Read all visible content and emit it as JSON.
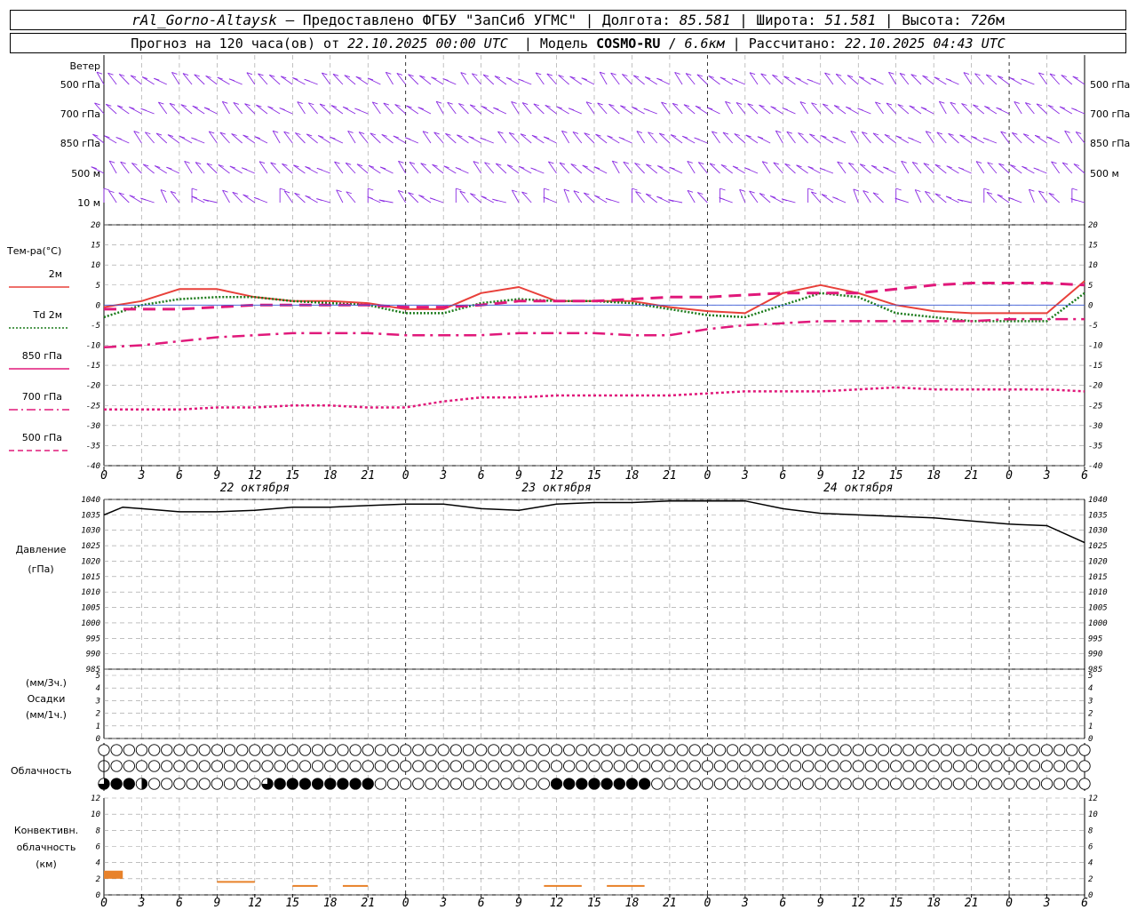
{
  "header": {
    "station": "rAl_Gorno-Altaysk",
    "provider": "Предоставлено ФГБУ \"ЗапСиб УГМС\"",
    "lon_label": "Долгота:",
    "lon": "85.581",
    "lat_label": "Широта:",
    "lat": "51.581",
    "alt_label": "Высота:",
    "alt": "726",
    "alt_unit": "м",
    "forecast_prefix": "Прогноз на 120 часа(ов) от",
    "forecast_from": "22.10.2025 00:00 UTC",
    "model_label": "Модель",
    "model": "COSMO-RU",
    "resolution": "6.6км",
    "computed_label": "Рассчитано:",
    "computed": "22.10.2025 04:43 UTC"
  },
  "colors": {
    "wind": "#8a2be2",
    "t2m": "#e8403a",
    "td2m": "#1a7a1a",
    "t850": "#e0187a",
    "t700": "#e0187a",
    "t500": "#e0187a",
    "grid": "#999999",
    "pressure": "#000000",
    "convective": "#e8822a"
  },
  "wind_panel": {
    "title": "Ветер",
    "levels": [
      "500 гПа",
      "700 гПа",
      "850 гПа",
      "500 м",
      "10 м"
    ]
  },
  "temp_panel": {
    "title": "Тем-ра(°С)",
    "legend": [
      {
        "label": "2м",
        "style": "solid",
        "color": "#e8403a"
      },
      {
        "label": "Td  2м",
        "style": "dotted",
        "color": "#1a7a1a"
      },
      {
        "label": "850 гПа",
        "style": "solid",
        "color": "#e0187a"
      },
      {
        "label": "700 гПа",
        "style": "dashdot",
        "color": "#e0187a"
      },
      {
        "label": "500 гПа",
        "style": "dashed",
        "color": "#e0187a"
      }
    ]
  },
  "pressure_panel": {
    "label1": "Давление",
    "label2": "(гПа)"
  },
  "precip_panel": {
    "label1": "(мм/3ч.)",
    "label2": "Осадки",
    "label3": "(мм/1ч.)"
  },
  "cloud_panel": {
    "label": "Облачность"
  },
  "conv_panel": {
    "label1": "Конвективн.",
    "label2": "облачность",
    "label3": "(км)"
  },
  "x_ticks": [
    "0",
    "3",
    "6",
    "9",
    "12",
    "15",
    "18",
    "21",
    "0",
    "3",
    "6",
    "9",
    "12",
    "15",
    "18",
    "21",
    "0",
    "3",
    "6",
    "9",
    "12",
    "15",
    "18",
    "21",
    "0",
    "3",
    "6"
  ],
  "day_labels": [
    "22 октября",
    "23 октября",
    "24 октября"
  ],
  "chart_data": [
    {
      "type": "line",
      "title": "Тем-ра(°С)",
      "x_hours": [
        0,
        3,
        6,
        9,
        12,
        15,
        18,
        21,
        24,
        27,
        30,
        33,
        36,
        39,
        42,
        45,
        48,
        51,
        54,
        57,
        60,
        63,
        66,
        69,
        72,
        75,
        78
      ],
      "ylim": [
        -40,
        20
      ],
      "yticks": [
        -40,
        -35,
        -30,
        -25,
        -20,
        -15,
        -10,
        -5,
        0,
        5,
        10,
        15,
        20
      ],
      "series": [
        {
          "name": "2м",
          "values": [
            -0.5,
            1,
            4,
            4,
            2,
            1,
            1,
            0.5,
            -1,
            -1,
            3,
            4.5,
            1,
            1,
            1,
            -0.5,
            -1.5,
            -2,
            3,
            5,
            3,
            0,
            -1.5,
            -2,
            -2,
            -2,
            6
          ]
        },
        {
          "name": "Td  2м",
          "values": [
            -3,
            0,
            1.5,
            2,
            2,
            1,
            0.5,
            0,
            -2,
            -2,
            0.5,
            1.5,
            1,
            1,
            0.5,
            -1,
            -2.5,
            -3,
            0,
            3,
            2,
            -2,
            -3,
            -4,
            -4,
            -4,
            3
          ]
        },
        {
          "name": "850 гПа",
          "values": [
            -1,
            -1,
            -1,
            -0.5,
            0,
            0,
            0,
            0,
            -0.5,
            -0.5,
            0,
            1,
            1,
            1,
            1.5,
            2,
            2,
            2.5,
            3,
            3,
            3,
            4,
            5,
            5.5,
            5.5,
            5.5,
            5
          ]
        },
        {
          "name": "700 гПа",
          "values": [
            -10.5,
            -10,
            -9,
            -8,
            -7.5,
            -7,
            -7,
            -7,
            -7.5,
            -7.5,
            -7.5,
            -7,
            -7,
            -7,
            -7.5,
            -7.5,
            -6,
            -5,
            -4.5,
            -4,
            -4,
            -4,
            -4,
            -4,
            -3.5,
            -3.5,
            -3.5
          ]
        },
        {
          "name": "500 гПа",
          "values": [
            -26,
            -26,
            -26,
            -25.5,
            -25.5,
            -25,
            -25,
            -25.5,
            -25.5,
            -24,
            -23,
            -23,
            -22.5,
            -22.5,
            -22.5,
            -22.5,
            -22,
            -21.5,
            -21.5,
            -21.5,
            -21,
            -20.5,
            -21,
            -21,
            -21,
            -21,
            -21.5
          ]
        }
      ]
    },
    {
      "type": "line",
      "title": "Давление (гПа)",
      "x_hours": [
        0,
        1.5,
        3,
        6,
        9,
        12,
        15,
        18,
        21,
        24,
        27,
        30,
        33,
        36,
        39,
        42,
        45,
        48,
        51,
        54,
        57,
        60,
        63,
        66,
        69,
        72,
        75,
        78
      ],
      "ylim": [
        985,
        1040
      ],
      "yticks": [
        985,
        990,
        995,
        1000,
        1005,
        1010,
        1015,
        1020,
        1025,
        1030,
        1035,
        1040
      ],
      "series": [
        {
          "name": "Давление",
          "values": [
            1035,
            1037.5,
            1037,
            1036,
            1036,
            1036.5,
            1037.5,
            1037.5,
            1038,
            1038.5,
            1038.5,
            1037,
            1036.5,
            1038.5,
            1039,
            1039,
            1039.5,
            1039.5,
            1039.5,
            1037,
            1035.5,
            1035,
            1034.5,
            1034,
            1033,
            1032,
            1031.5,
            1026
          ]
        }
      ]
    },
    {
      "type": "bar",
      "title": "Осадки",
      "ylim": [
        0,
        5
      ],
      "yticks": [
        0,
        1,
        2,
        3,
        4,
        5
      ],
      "values": []
    },
    {
      "type": "bar",
      "title": "Конвективн. облачность (км)",
      "ylim": [
        0,
        12
      ],
      "yticks": [
        0,
        2,
        4,
        6,
        8,
        10,
        12
      ],
      "segments": [
        {
          "from": 0,
          "to": 1.5,
          "base": 2,
          "top": 3
        },
        {
          "from": 9,
          "to": 12,
          "base": 1.5,
          "top": 1.5
        },
        {
          "from": 15,
          "to": 17,
          "base": 1,
          "top": 1
        },
        {
          "from": 19,
          "to": 21,
          "base": 1,
          "top": 1
        },
        {
          "from": 35,
          "to": 38,
          "base": 1,
          "top": 1
        },
        {
          "from": 40,
          "to": 43,
          "base": 1,
          "top": 1
        }
      ]
    }
  ],
  "clouds": {
    "rows": 3,
    "count": 79,
    "high": [
      0,
      0,
      0,
      0,
      0,
      0,
      0,
      0,
      0,
      0,
      0,
      0,
      0,
      0,
      0,
      0,
      0,
      0,
      0,
      0,
      0,
      0,
      0,
      0,
      0,
      0,
      0,
      0,
      0,
      0,
      0,
      0,
      0,
      0,
      0,
      0,
      0,
      0,
      0,
      0,
      0,
      0,
      0,
      0,
      0,
      0,
      0,
      0,
      0,
      0,
      0,
      0,
      0,
      0,
      0,
      0,
      0,
      0,
      0,
      0,
      0,
      0,
      0,
      0,
      0,
      0,
      0,
      0,
      0,
      0,
      0,
      0,
      0,
      0,
      0,
      0,
      0,
      0,
      0
    ],
    "middle": [
      1,
      0,
      0,
      0,
      0,
      0,
      0,
      0,
      0,
      0,
      0,
      0,
      0,
      0,
      0,
      0,
      0,
      0,
      0,
      0,
      0,
      0,
      0,
      0,
      0,
      0,
      0,
      0,
      0,
      0,
      0,
      0,
      0,
      0,
      0,
      0,
      0,
      0,
      0,
      0,
      0,
      0,
      0,
      0,
      0,
      0,
      0,
      0,
      0,
      0,
      0,
      0,
      0,
      0,
      0,
      0,
      0,
      0,
      0,
      0,
      0,
      0,
      0,
      0,
      0,
      0,
      0,
      0,
      0,
      0,
      0,
      0,
      0,
      0,
      0,
      0,
      0,
      0,
      0
    ],
    "low": [
      3,
      4,
      4,
      2,
      0,
      0,
      0,
      0,
      0,
      0,
      0,
      0,
      0,
      3,
      4,
      4,
      4,
      4,
      4,
      4,
      4,
      4,
      0,
      0,
      0,
      0,
      0,
      0,
      0,
      0,
      0,
      0,
      0,
      0,
      0,
      0,
      4,
      4,
      4,
      4,
      4,
      4,
      4,
      4,
      0,
      0,
      0,
      0,
      0,
      0,
      0,
      0,
      0,
      0,
      0,
      0,
      0,
      0,
      0,
      0,
      0,
      0,
      0,
      0,
      0,
      0,
      0,
      0,
      0,
      0,
      0,
      0,
      0,
      0,
      0,
      0,
      0,
      0,
      0
    ]
  }
}
